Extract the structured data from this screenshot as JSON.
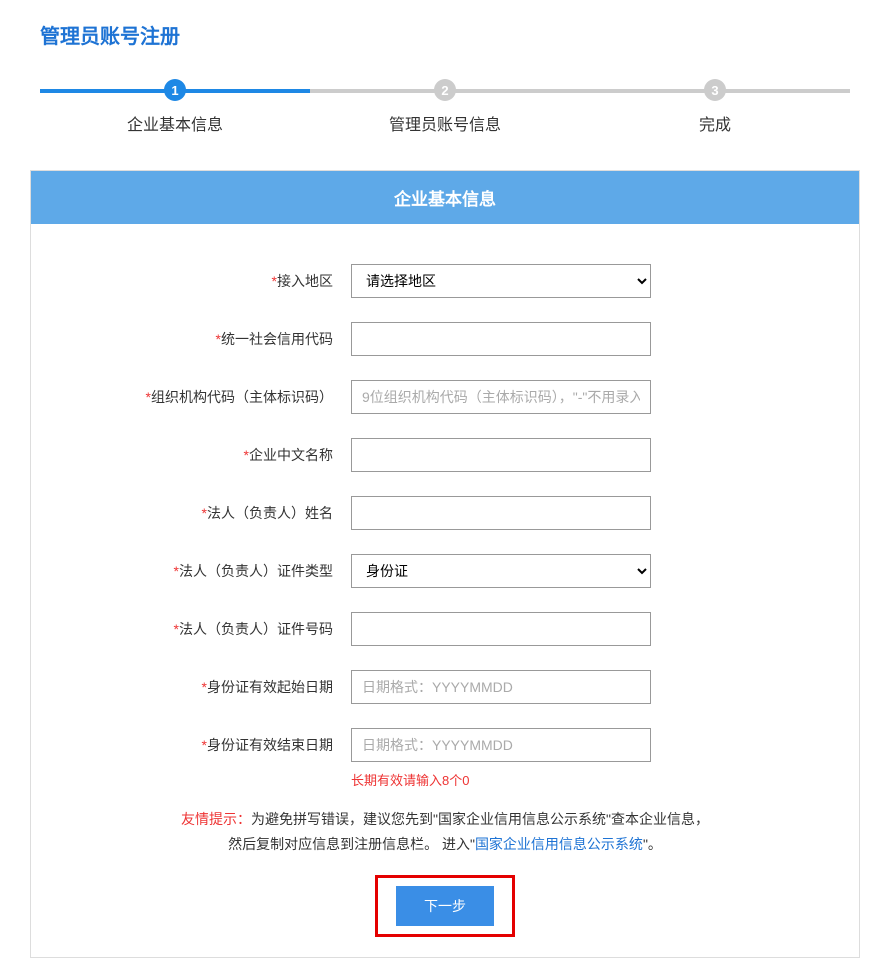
{
  "page_title": "管理员账号注册",
  "steps": {
    "s1": {
      "num": "1",
      "label": "企业基本信息"
    },
    "s2": {
      "num": "2",
      "label": "管理员账号信息"
    },
    "s3": {
      "num": "3",
      "label": "完成"
    }
  },
  "form": {
    "header": "企业基本信息",
    "fields": {
      "region": {
        "label": "接入地区",
        "placeholder": "请选择地区"
      },
      "credit_code": {
        "label": "统一社会信用代码"
      },
      "org_code": {
        "label": "组织机构代码（主体标识码）",
        "placeholder": "9位组织机构代码（主体标识码），\"-\"不用录入"
      },
      "company_name": {
        "label": "企业中文名称"
      },
      "legal_name": {
        "label": "法人（负责人）姓名"
      },
      "id_type": {
        "label": "法人（负责人）证件类型",
        "option": "身份证"
      },
      "id_number": {
        "label": "法人（负责人）证件号码"
      },
      "id_start": {
        "label": "身份证有效起始日期",
        "placeholder": "日期格式：YYYYMMDD"
      },
      "id_end": {
        "label": "身份证有效结束日期",
        "placeholder": "日期格式：YYYYMMDD",
        "hint": "长期有效请输入8个0"
      }
    }
  },
  "tip": {
    "label": "友情提示：",
    "text1": "为避免拼写错误，建议您先到\"国家企业信用信息公示系统\"查本企业信息，",
    "text2": "然后复制对应信息到注册信息栏。 进入\"",
    "link": "国家企业信用信息公示系统",
    "text3": "\"。"
  },
  "button": {
    "next": "下一步"
  }
}
